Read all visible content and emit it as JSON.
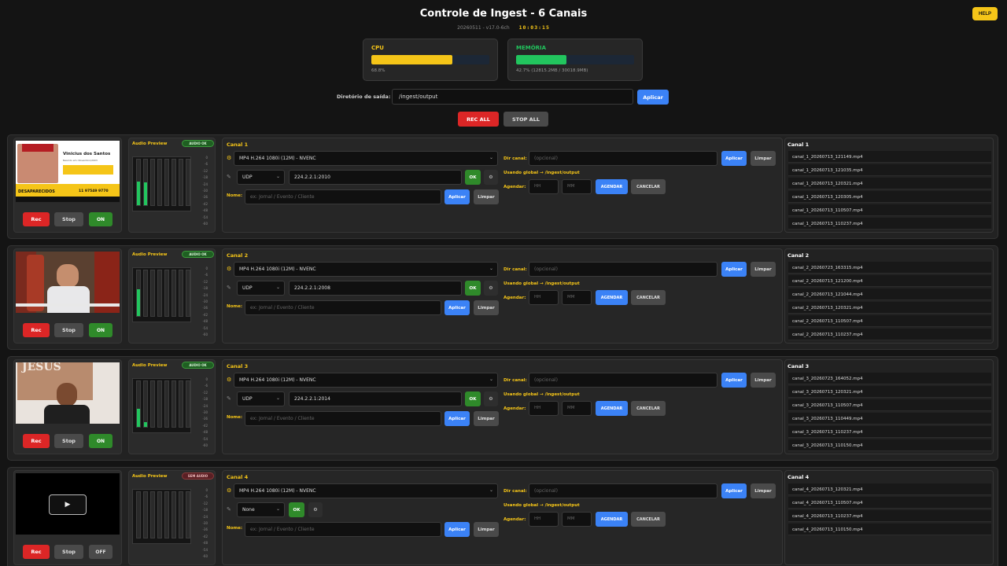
{
  "header": {
    "title": "Controle de Ingest - 6 Canais",
    "version": "20260511 - v17.0-6ch",
    "clock": "10:03:15",
    "help_label": "HELP"
  },
  "meters": {
    "cpu": {
      "label": "CPU",
      "value_text": "68.8%",
      "fraction": 0.688,
      "color": "#f5c518"
    },
    "memory": {
      "label": "MEMÓRIA",
      "value_text": "42.7% (12815.2MB / 30018.9MB)",
      "fraction": 0.427,
      "color": "#22c55e"
    }
  },
  "output_dir": {
    "label": "Diretório de saída:",
    "value": "/ingest/output",
    "apply_label": "Aplicar"
  },
  "global_controls": {
    "rec_all": "REC ALL",
    "stop_all": "STOP ALL"
  },
  "common": {
    "rec": "Rec",
    "stop": "Stop",
    "audio_preview": "Audio Preview",
    "codec": "MP4 H.264 1080i (12M) - NVENC",
    "ok": "OK",
    "opt": "⚙",
    "name_label": "Nome:",
    "name_placeholder": "ex: Jornal / Evento / Cliente",
    "apply": "Aplicar",
    "clear": "Limpar",
    "dir_label": "Dir canal:",
    "dir_placeholder": "(opcional)",
    "global_note": "Usando global → /ingest/output",
    "schedule_label": "Agendar:",
    "hh": "HH",
    "mm": "MM",
    "schedule_btn": "AGENDAR",
    "cancel_btn": "CANCELAR",
    "vu_scale": [
      "0",
      "-6",
      "-12",
      "-18",
      "-24",
      "-30",
      "-36",
      "-42",
      "-48",
      "-54",
      "-60"
    ]
  },
  "channels": [
    {
      "title": "Canal 1",
      "files_title": "Canal 1",
      "toggle": "ON",
      "audio_badge": "AUDIO OK",
      "audio_ok": true,
      "protocol": "UDP",
      "address": "224.2.2.1:2010",
      "levels": [
        0.52,
        0.5,
        0,
        0,
        0,
        0,
        0,
        0
      ],
      "thumb": {
        "name": "Vinicius dos Santos",
        "line": "Nascido em: Novembro/2003",
        "tag": "DESAPARECIDOS",
        "phone": "11 97549 9770"
      },
      "files": [
        "canal_1_20260713_121149.mp4",
        "canal_1_20260713_121035.mp4",
        "canal_1_20260713_120321.mp4",
        "canal_1_20260713_120305.mp4",
        "canal_1_20260713_110507.mp4",
        "canal_1_20260713_110237.mp4"
      ]
    },
    {
      "title": "Canal 2",
      "files_title": "Canal 2",
      "toggle": "ON",
      "audio_badge": "AUDIO OK",
      "audio_ok": true,
      "protocol": "UDP",
      "address": "224.2.2.1:2008",
      "levels": [
        0.58,
        0,
        0,
        0,
        0,
        0,
        0,
        0
      ],
      "files": [
        "canal_2_20260723_163315.mp4",
        "canal_2_20260713_121200.mp4",
        "canal_2_20260713_121044.mp4",
        "canal_2_20260713_120321.mp4",
        "canal_2_20260713_110507.mp4",
        "canal_2_20260713_110237.mp4"
      ]
    },
    {
      "title": "Canal 3",
      "files_title": "Canal 3",
      "toggle": "ON",
      "audio_badge": "AUDIO OK",
      "audio_ok": true,
      "protocol": "UDP",
      "address": "224.2.2.1:2014",
      "levels": [
        0.4,
        0.1,
        0,
        0,
        0,
        0,
        0,
        0
      ],
      "thumb": {
        "banner": "JESUS"
      },
      "files": [
        "canal_3_20260723_164052.mp4",
        "canal_3_20260713_120321.mp4",
        "canal_3_20260713_110507.mp4",
        "canal_3_20260713_110449.mp4",
        "canal_3_20260713_110237.mp4",
        "canal_3_20260713_110150.mp4"
      ]
    },
    {
      "title": "Canal 4",
      "files_title": "Canal 4",
      "toggle": "OFF",
      "audio_badge": "SEM AUDIO",
      "audio_ok": false,
      "protocol": "None",
      "address": null,
      "levels": [
        0,
        0,
        0,
        0,
        0,
        0,
        0,
        0
      ],
      "files": [
        "canal_4_20260713_120321.mp4",
        "canal_4_20260713_110507.mp4",
        "canal_4_20260713_110237.mp4",
        "canal_4_20260713_110150.mp4"
      ]
    }
  ]
}
